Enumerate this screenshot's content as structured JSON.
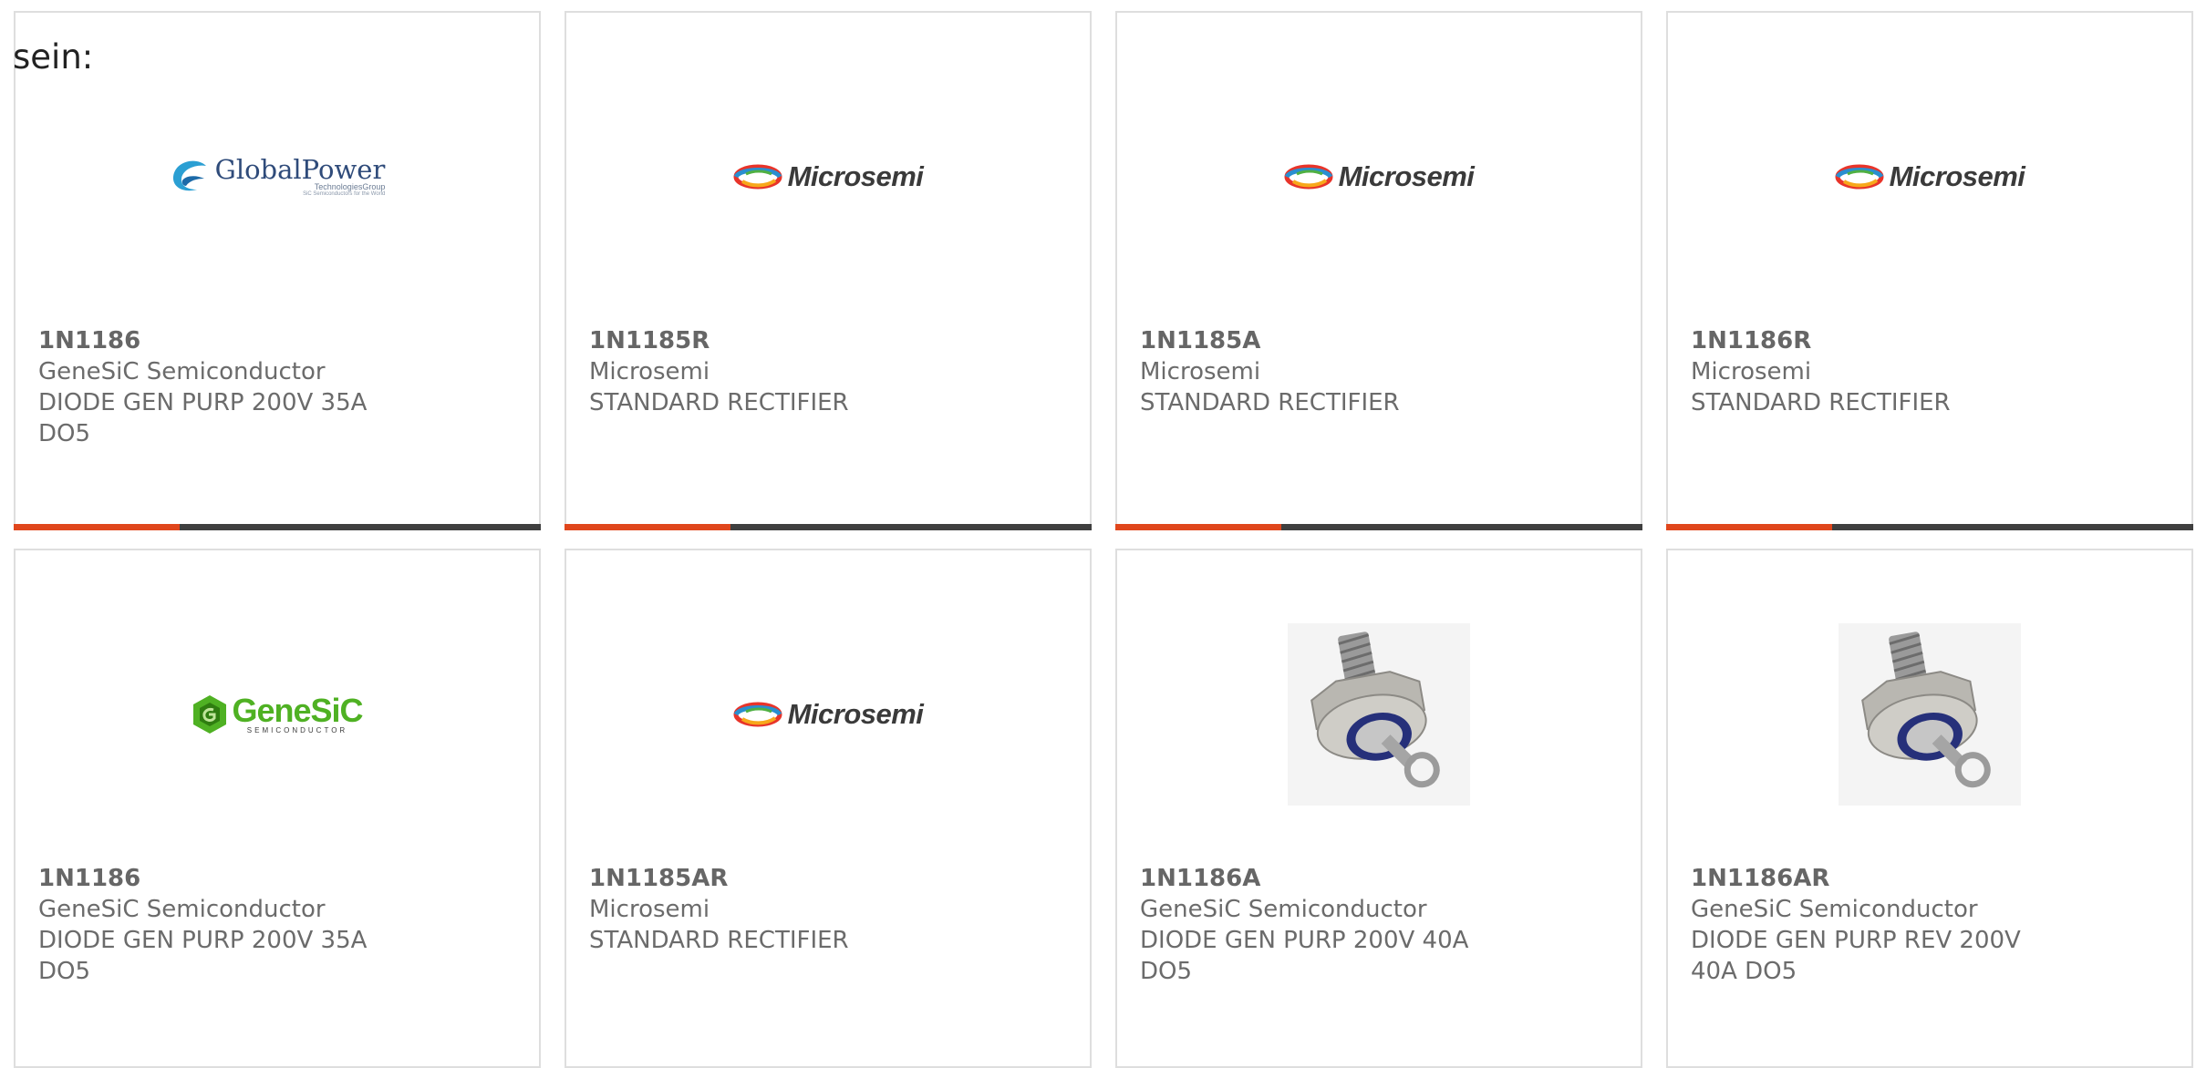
{
  "intro_text": "sein:",
  "cards": [
    {
      "part_number": "1N1186",
      "manufacturer": "GeneSiC Semiconductor",
      "description": "DIODE GEN PURP 200V 35A DO5",
      "logo": "globalpower-logo",
      "logo_main": "GlobalPower",
      "logo_sub": "TechnologiesGroup",
      "logo_sub2": "SiC Semiconductors for the World"
    },
    {
      "part_number": "1N1185R",
      "manufacturer": "Microsemi",
      "description": "STANDARD RECTIFIER",
      "logo": "microsemi-logo",
      "logo_main": "Microsemi"
    },
    {
      "part_number": "1N1185A",
      "manufacturer": "Microsemi",
      "description": "STANDARD RECTIFIER",
      "logo": "microsemi-logo",
      "logo_main": "Microsemi"
    },
    {
      "part_number": "1N1186R",
      "manufacturer": "Microsemi",
      "description": "STANDARD RECTIFIER",
      "logo": "microsemi-logo",
      "logo_main": "Microsemi"
    },
    {
      "part_number": "1N1186",
      "manufacturer": "GeneSiC Semiconductor",
      "description": "DIODE GEN PURP 200V 35A DO5",
      "logo": "genesic-logo",
      "logo_main": "GeneSiC",
      "logo_sub": "SEMICONDUCTOR"
    },
    {
      "part_number": "1N1185AR",
      "manufacturer": "Microsemi",
      "description": "STANDARD RECTIFIER",
      "logo": "microsemi-logo",
      "logo_main": "Microsemi"
    },
    {
      "part_number": "1N1186A",
      "manufacturer": "GeneSiC Semiconductor",
      "description": "DIODE GEN PURP 200V 40A DO5",
      "logo": "stud-diode-photo"
    },
    {
      "part_number": "1N1186AR",
      "manufacturer": "GeneSiC Semiconductor",
      "description": "DIODE GEN PURP REV 200V 40A DO5",
      "logo": "stud-diode-photo"
    }
  ],
  "colors": {
    "accent": "#e0461c",
    "bar": "#3f3f3f",
    "border": "#dedede",
    "text": "#6b6b6b"
  }
}
